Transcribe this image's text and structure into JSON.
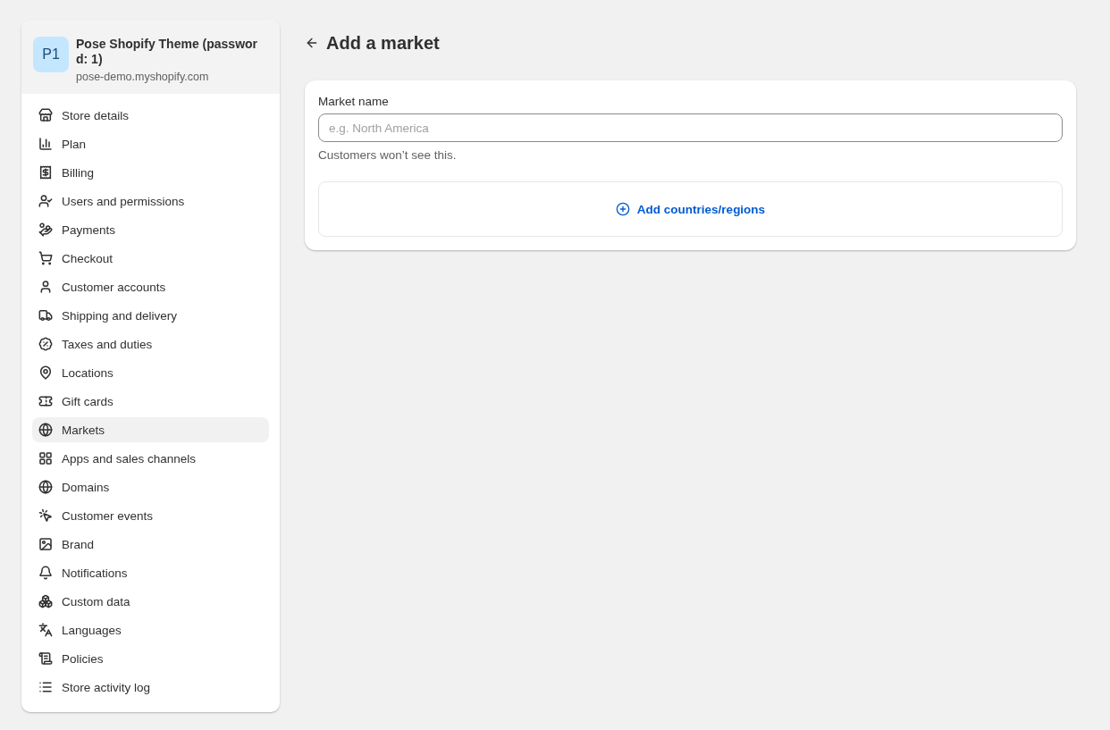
{
  "store": {
    "avatar": "P1",
    "name": "Pose Shopify Theme (passwor d: 1)",
    "domain": "pose-demo.myshopify.com"
  },
  "sidebar": {
    "items": [
      {
        "label": "Store details",
        "selected": false
      },
      {
        "label": "Plan",
        "selected": false
      },
      {
        "label": "Billing",
        "selected": false
      },
      {
        "label": "Users and permissions",
        "selected": false
      },
      {
        "label": "Payments",
        "selected": false
      },
      {
        "label": "Checkout",
        "selected": false
      },
      {
        "label": "Customer accounts",
        "selected": false
      },
      {
        "label": "Shipping and delivery",
        "selected": false
      },
      {
        "label": "Taxes and duties",
        "selected": false
      },
      {
        "label": "Locations",
        "selected": false
      },
      {
        "label": "Gift cards",
        "selected": false
      },
      {
        "label": "Markets",
        "selected": true
      },
      {
        "label": "Apps and sales channels",
        "selected": false
      },
      {
        "label": "Domains",
        "selected": false
      },
      {
        "label": "Customer events",
        "selected": false
      },
      {
        "label": "Brand",
        "selected": false
      },
      {
        "label": "Notifications",
        "selected": false
      },
      {
        "label": "Custom data",
        "selected": false
      },
      {
        "label": "Languages",
        "selected": false
      },
      {
        "label": "Policies",
        "selected": false
      },
      {
        "label": "Store activity log",
        "selected": false
      }
    ]
  },
  "page": {
    "title": "Add a market",
    "field": {
      "label": "Market name",
      "placeholder": "e.g. North America",
      "help": "Customers won’t see this."
    },
    "add_button": "Add countries/regions"
  }
}
